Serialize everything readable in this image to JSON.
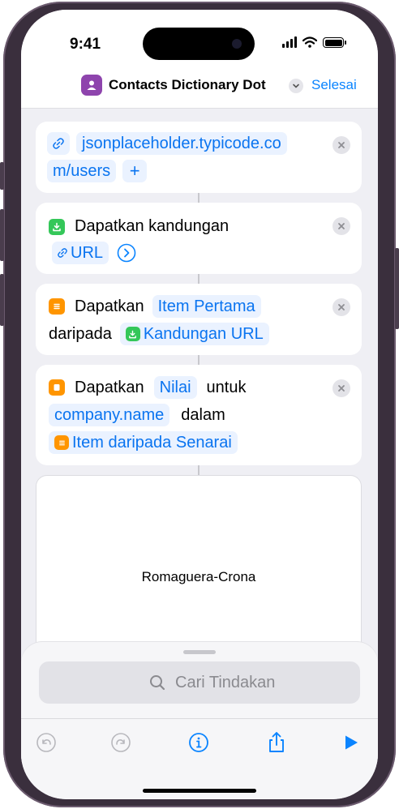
{
  "status": {
    "time": "9:41"
  },
  "nav": {
    "title": "Contacts Dictionary Dot",
    "done_label": "Selesai"
  },
  "cards": {
    "url": {
      "line1": "jsonplaceholder.typicode.co",
      "line2": "m/users",
      "add_glyph": "+"
    },
    "get_contents": {
      "action": "Dapatkan kandungan",
      "token": "URL"
    },
    "get_item": {
      "action": "Dapatkan",
      "token": "Item Pertama",
      "from": "daripada",
      "source": "Kandungan URL"
    },
    "get_value": {
      "action": "Dapatkan",
      "token": "Nilai",
      "for": "untuk",
      "key": "company.name",
      "in": "dalam",
      "source": "Item daripada Senarai"
    }
  },
  "result": {
    "text": "Romaguera-Crona"
  },
  "search": {
    "placeholder": "Cari Tindakan"
  },
  "icons": {
    "app": "person-crop-icon",
    "link": "link-icon",
    "download": "download-icon",
    "list": "list-icon",
    "dictionary": "dictionary-icon",
    "clear": "xmark-circle-icon",
    "undo": "undo-icon",
    "redo": "redo-icon",
    "info": "info-icon",
    "share": "share-icon",
    "run": "play-icon"
  },
  "colors": {
    "accent": "#0a84ff",
    "app_icon": "#8e44ad",
    "green": "#34c759",
    "orange": "#ff9500",
    "frame": "#3a2f3d"
  }
}
